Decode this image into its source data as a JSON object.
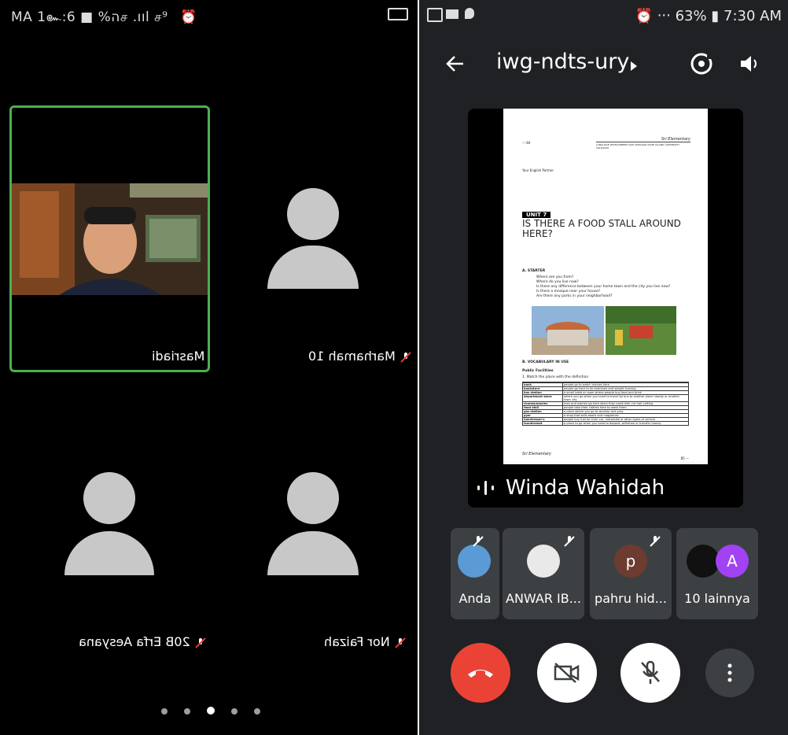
{
  "left": {
    "status_text": "MA 1๛:6 ■ %הச .ııl ச⁹",
    "tiles": [
      {
        "name": "Masriadi",
        "muted": false,
        "active": true
      },
      {
        "name": "Marhamah 10",
        "muted": true,
        "active": false
      },
      {
        "name": "20B Erfa Aesyana",
        "muted": true,
        "active": false
      },
      {
        "name": "Nor Faizah",
        "muted": true,
        "active": false
      }
    ],
    "page_dots": 5,
    "active_dot": 2
  },
  "right": {
    "status": {
      "battery": "63%",
      "time": "7:30 AM"
    },
    "meeting_code": "iwg-ndts-ury",
    "presenter_name": "Winda Wahidah",
    "document": {
      "page_header": "Sri Elementary",
      "page_number_left": "— 84",
      "university_line": "LANGUAGE DEVELOPMENT UNIT ANTASARI STATE ISLAMIC UNIVERSITY 2019/2020",
      "partner": "Your English Partner",
      "unit": "UNIT 7",
      "title": "IS THERE A FOOD STALL AROUND HERE?",
      "section_a": "A.  STARTER",
      "starter_questions": [
        "Where are you from?",
        "Where do you live now?",
        "Is there any difference between your home town and the city you live now?",
        "Is there a mosque near your house?",
        "Are there any parks in your neighborhood?"
      ],
      "section_b": "B.  VOCABULARY IN USE",
      "public_facilities": "Public Facilities",
      "instruction": "1.   Match the place with the definition",
      "vocab_rows": [
        {
          "place": "bank",
          "definition": "people go to watch movies here"
        },
        {
          "place": "bookstore",
          "definition": "people go here to do exercises and weight training"
        },
        {
          "place": "bus station",
          "definition": "a small table or room where people buy food and drink"
        },
        {
          "place": "department store",
          "definition": "where you go when you need to travel by bus to another place nearby or another town city"
        },
        {
          "place": "cinema/movies",
          "definition": "men and women go here when they need their cut hair cutting"
        },
        {
          "place": "food stall",
          "definition": "people take their clothes here to wash them"
        },
        {
          "place": "gas station",
          "definition": "a place where you go to worship and pray"
        },
        {
          "place": "gym",
          "definition": "a shop that sells books and magazines"
        },
        {
          "place": "hairdresser's",
          "definition": "people buy fuel for their car, motorbike or other types of vehicle"
        },
        {
          "place": "laundromat",
          "definition": "a place to go when you need to deposit, withdraw or transfer money"
        }
      ],
      "footer_left": "Sri Elementary",
      "footer_page": "85 —"
    },
    "participants": [
      {
        "name": "Anda",
        "muted": true,
        "avatar_color": "#5b9bd5"
      },
      {
        "name": "ANWAR IB...",
        "muted": true,
        "avatar_color": "#e9e9e9"
      },
      {
        "name": "pahru hid...",
        "muted": true,
        "avatar_color": "#6d3b2f",
        "initial": "p"
      },
      {
        "name": "10 lainnya",
        "muted": false,
        "avatar_color": "#a142f4",
        "initial": "A"
      }
    ],
    "colors": {
      "end_call": "#ea4335",
      "bg": "#202124",
      "tile": "#3c4043",
      "active_border": "#4caf50"
    }
  }
}
